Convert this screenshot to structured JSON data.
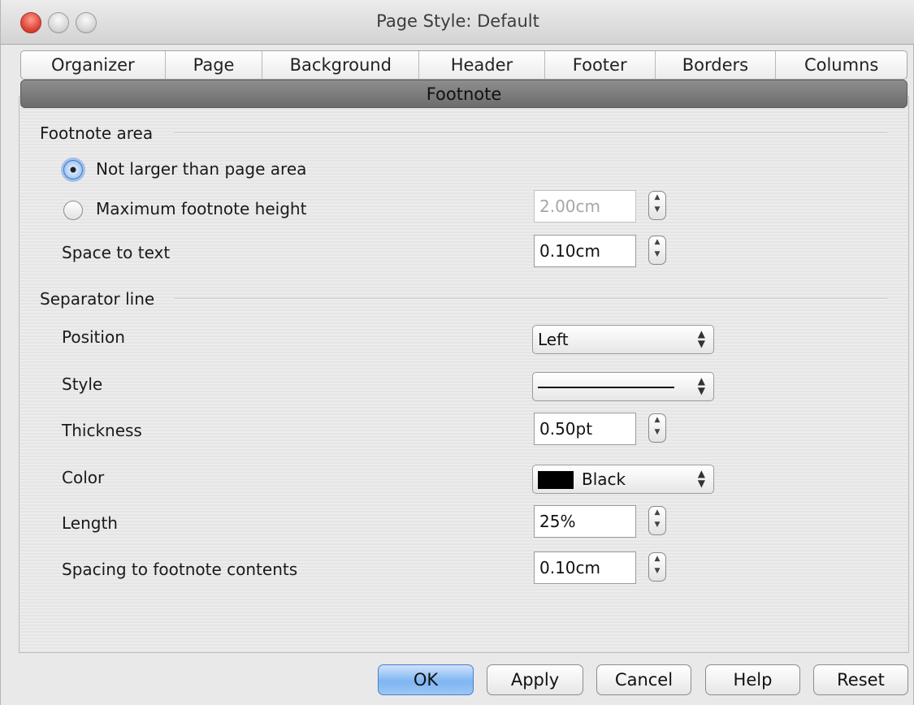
{
  "window": {
    "title": "Page Style: Default"
  },
  "tabs": [
    {
      "label": "Organizer"
    },
    {
      "label": "Page"
    },
    {
      "label": "Background"
    },
    {
      "label": "Header"
    },
    {
      "label": "Footer"
    },
    {
      "label": "Borders"
    },
    {
      "label": "Columns"
    }
  ],
  "selected_tab": {
    "label": "Footnote"
  },
  "footnote_area": {
    "heading": "Footnote area",
    "not_larger_label": "Not larger than page area",
    "max_height_label": "Maximum footnote height",
    "max_height_value": "2.00cm",
    "space_to_text_label": "Space to text",
    "space_to_text_value": "0.10cm",
    "selected_option": "Not larger than page area"
  },
  "separator_line": {
    "heading": "Separator line",
    "position_label": "Position",
    "position_value": "Left",
    "style_label": "Style",
    "thickness_label": "Thickness",
    "thickness_value": "0.50pt",
    "color_label": "Color",
    "color_value": "Black",
    "color_swatch": "#000000",
    "length_label": "Length",
    "length_value": "25%",
    "spacing_label": "Spacing to footnote contents",
    "spacing_value": "0.10cm"
  },
  "buttons": {
    "ok": "OK",
    "apply": "Apply",
    "cancel": "Cancel",
    "help": "Help",
    "reset": "Reset"
  },
  "icons": {
    "close": "close-icon",
    "minimize": "minimize-icon",
    "zoom": "zoom-icon",
    "stepper": "stepper-icon",
    "dropdown": "chevron-updown-icon"
  }
}
